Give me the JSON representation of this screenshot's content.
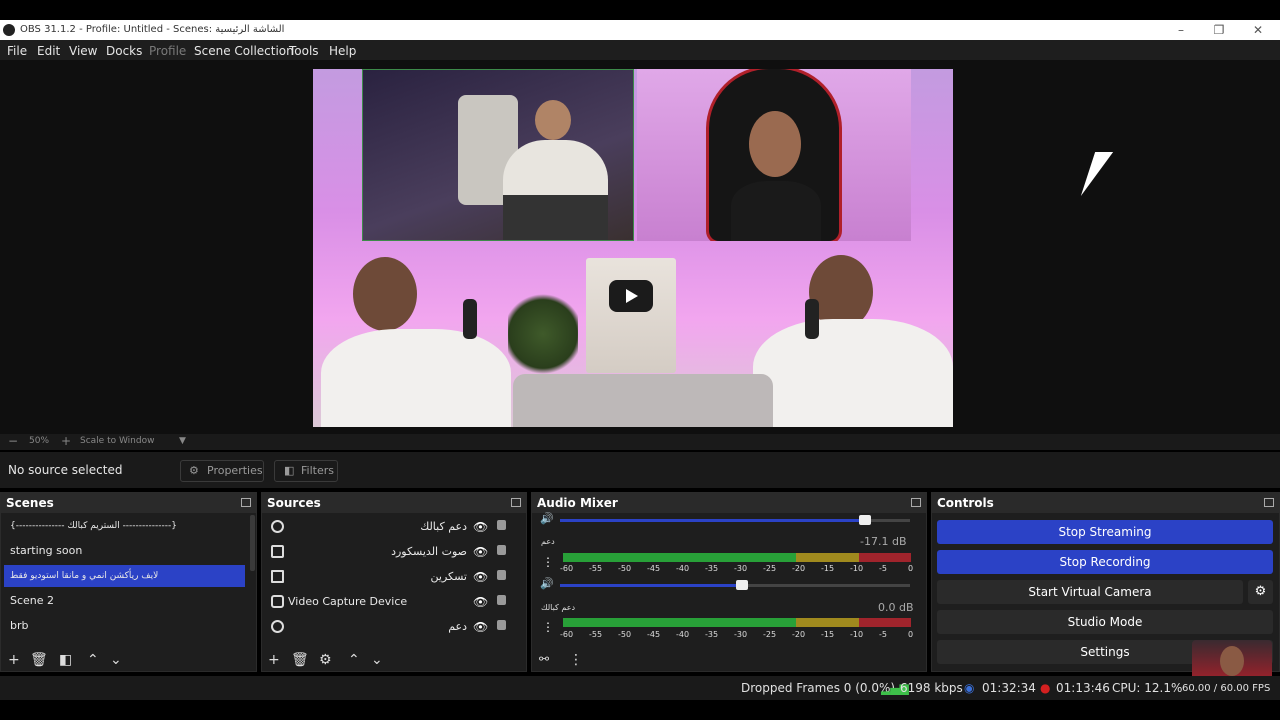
{
  "window": {
    "title": "OBS 31.1.2 - Profile: Untitled - Scenes: الشاشة الرئيسية"
  },
  "menu": [
    "File",
    "Edit",
    "View",
    "Docks",
    "Profile",
    "Scene Collection",
    "Tools",
    "Help"
  ],
  "preview": {
    "zoom": "50%",
    "scale_mode": "Scale to Window",
    "overlay_logo": "YouTube"
  },
  "source_bar": {
    "status": "No source selected",
    "properties_label": "Properties",
    "filters_label": "Filters"
  },
  "scenes": {
    "title": "Scenes",
    "items": [
      {
        "label": "{--------------- الستريم كبالك ---------------}",
        "selected": false
      },
      {
        "label": "starting soon",
        "selected": false
      },
      {
        "label": "لايف ريأكشن انمي و مانقا استوديو فقط",
        "selected": true
      },
      {
        "label": "Scene 2",
        "selected": false
      },
      {
        "label": "brb",
        "selected": false
      }
    ]
  },
  "sources": {
    "title": "Sources",
    "items": [
      {
        "label": "دعم كبالك",
        "icon": "globe-icon"
      },
      {
        "label": "صوت الديسكورد",
        "icon": "audio-output-icon"
      },
      {
        "label": "تسكرين",
        "icon": "monitor-icon"
      },
      {
        "label": "Video Capture Device",
        "icon": "camera-icon"
      },
      {
        "label": "دعم",
        "icon": "globe-icon"
      }
    ]
  },
  "audio_mixer": {
    "title": "Audio Mixer",
    "channels": [
      {
        "name": "دعم",
        "db": "-17.1 dB",
        "volume_fraction": 0.87
      },
      {
        "name": "دعم كبالك",
        "db": "0.0 dB",
        "volume_fraction": 0.52
      }
    ],
    "ticks": [
      "-60",
      "-55",
      "-50",
      "-45",
      "-40",
      "-35",
      "-30",
      "-25",
      "-20",
      "-15",
      "-10",
      "-5",
      "0"
    ]
  },
  "controls": {
    "title": "Controls",
    "stop_streaming": "Stop Streaming",
    "stop_recording": "Stop Recording",
    "start_virtual_camera": "Start Virtual Camera",
    "studio_mode": "Studio Mode",
    "settings": "Settings"
  },
  "status": {
    "dropped_frames": "Dropped Frames 0 (0.0%)",
    "bitrate": "6198 kbps",
    "stream_time": "01:32:34",
    "rec_time": "01:13:46",
    "cpu": "CPU: 12.1%",
    "fps": "60.00 / 60.00 FPS"
  },
  "colors": {
    "accent": "#2b42c6",
    "panel": "#1e1e1e",
    "dock_title": "#2a2a2a",
    "meter_green": "#28a038",
    "meter_yellow": "#a08a1e",
    "meter_red": "#a0242c"
  }
}
